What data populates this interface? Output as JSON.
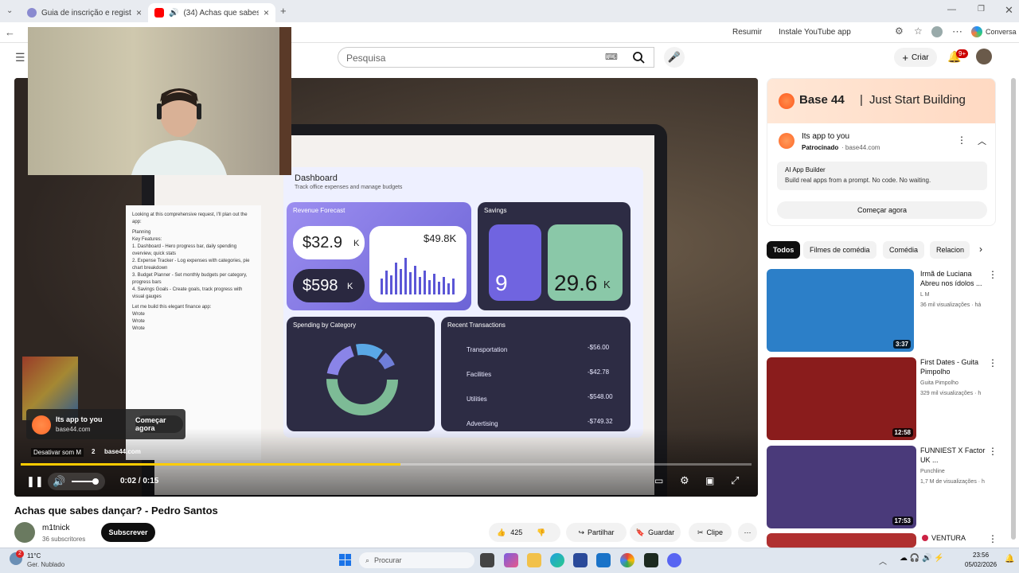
{
  "browser": {
    "tabs": [
      {
        "label": "Guia de inscrição e registro no Do",
        "active": false
      },
      {
        "label": "(34) Achas que sabes dançar?",
        "active": true
      }
    ],
    "toolbar": {
      "resume": "Resumir",
      "install": "Instale YouTube app",
      "copilot": "Conversa"
    }
  },
  "yt": {
    "search_placeholder": "Pesquisa",
    "create_label": "Criar",
    "notif_badge": "9+"
  },
  "player": {
    "ad_title": "Its app to you",
    "ad_domain": "base44.com",
    "ad_cta": "Começar agora",
    "mute_tooltip": "Desativar som",
    "mute_key": "M",
    "ad_counter": "2",
    "ad_domain_bottom": "base44.com",
    "time": "0:02 / 0:15",
    "progress": 0.52
  },
  "screen_content": {
    "dashboard_title": "Dashboard",
    "dashboard_sub": "Track office expenses and manage budgets",
    "revenue": "Revenue Forecast",
    "v1": "$32.9",
    "v1u": "K",
    "v2": "$598",
    "v2u": "K",
    "v3": "$49.8K",
    "savings": "Savings",
    "s1": "9",
    "s2": "29.6",
    "s2u": "K",
    "spending": "Spending by Category",
    "recent": "Recent Transactions",
    "tx": [
      {
        "name": "Transportation",
        "amt": "-$56.00"
      },
      {
        "name": "Facilities",
        "amt": "-$42.78"
      },
      {
        "name": "Utilities",
        "amt": "-$548.00"
      },
      {
        "name": "Advertising",
        "amt": "-$749.32"
      }
    ],
    "chat_lines": [
      "Looking at this comprehensive request, I'll plan out the app:",
      "Planning",
      "Key Features:",
      "1. Dashboard - Hero progress bar, daily spending overview, quick stats",
      "2. Expense Tracker - Log expenses with categories, pie chart breakdown",
      "3. Budget Planner - Set monthly budgets per category, progress bars",
      "4. Savings Goals - Create goals, track progress with visual gauges",
      "Let me build this elegant finance app:",
      "Wrote",
      "Wrote",
      "Wrote"
    ]
  },
  "video": {
    "title": "Achas que sabes dançar? - Pedro Santos",
    "channel": "m1tnick",
    "subs": "36 subscritores",
    "subscribe": "Subscrever",
    "likes": "425",
    "share": "Partilhar",
    "save": "Guardar",
    "clip": "Clipe"
  },
  "sidebar": {
    "ad": {
      "brand": "Base 44",
      "tagline": "Just Start Building",
      "title": "Its app to you",
      "sponsored": "Patrocinado",
      "domain": "base44.com",
      "box_title": "AI App Builder",
      "box_desc": "Build real apps from a prompt. No code. No waiting.",
      "cta": "Começar agora"
    },
    "chips": [
      "Todos",
      "Filmes de comédia",
      "Comédia",
      "Relacion"
    ],
    "videos": [
      {
        "title": "Irmã de Luciana Abreu nos ídolos ...",
        "channel": "L M",
        "meta": "36 mil visualizações · há",
        "duration": "3:37",
        "color": "#2c7fc8"
      },
      {
        "title": "First Dates - Guita Pimpolho",
        "channel": "Guita Pimpolho",
        "meta": "329 mil visualizações · h",
        "duration": "12:58",
        "color": "#8a1c1c"
      },
      {
        "title": "FUNNIEST X Factor UK ...",
        "channel": "Punchline",
        "meta": "1,7 M de visualizações · h",
        "duration": "17:53",
        "color": "#4a3a7a"
      },
      {
        "title": "VENTURA",
        "channel": "",
        "meta": "",
        "duration": "",
        "color": "#b03030"
      }
    ]
  },
  "taskbar": {
    "weather_temp": "11°C",
    "weather_desc": "Ger. Nublado",
    "search": "Procurar",
    "time": "23:56",
    "date": "05/02/2026"
  }
}
